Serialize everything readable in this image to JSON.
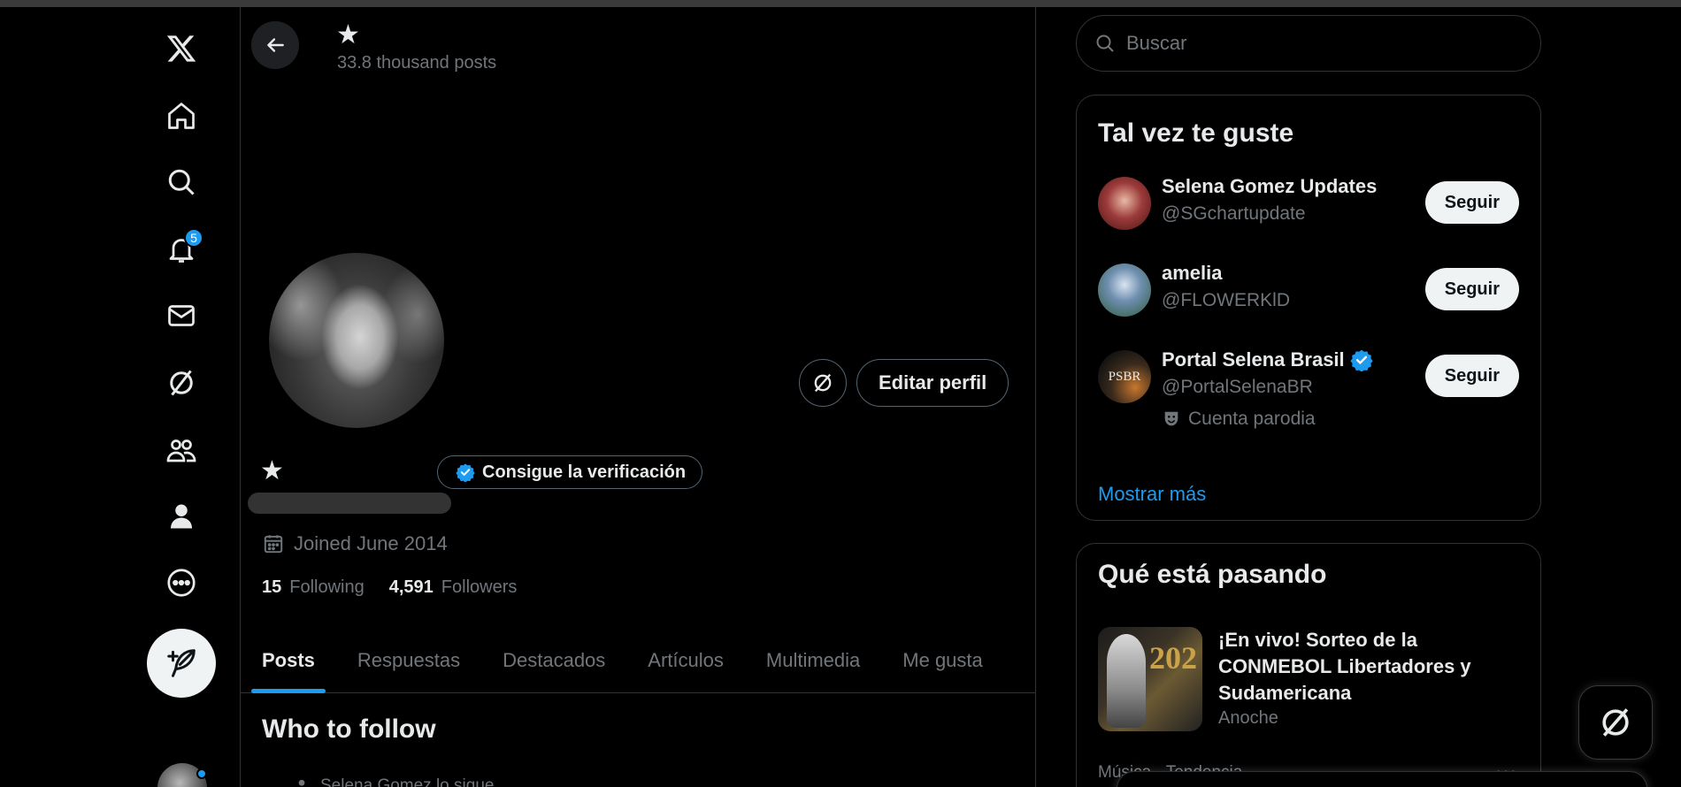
{
  "nav": {
    "logo": "x-logo-icon",
    "items": [
      {
        "name": "home-icon"
      },
      {
        "name": "search-icon"
      },
      {
        "name": "notifications-icon",
        "badge": "5"
      },
      {
        "name": "messages-icon"
      },
      {
        "name": "grok-icon"
      },
      {
        "name": "communities-icon"
      },
      {
        "name": "profile-icon"
      },
      {
        "name": "more-icon"
      }
    ],
    "post_button_icon": "compose-icon"
  },
  "header": {
    "name": "★",
    "posts_count": "33.8 thousand posts"
  },
  "profile": {
    "display_name": "★",
    "verify_label": "Consigue la verificación",
    "edit_label": "Editar perfil",
    "joined": "Joined June 2014",
    "following_count": "15",
    "following_label": "Following",
    "followers_count": "4,591",
    "followers_label": "Followers"
  },
  "tabs": [
    "Posts",
    "Respuestas",
    "Destacados",
    "Artículos",
    "Multimedia",
    "Me gusta"
  ],
  "who_to_follow": {
    "title": "Who to follow",
    "sub": "Selena Gomez lo sigue"
  },
  "search": {
    "placeholder": "Buscar"
  },
  "suggestions": {
    "title": "Tal vez te guste",
    "follow_label": "Seguir",
    "items": [
      {
        "name": "Selena Gomez Updates",
        "handle": "@SGchartupdate"
      },
      {
        "name": "amelia",
        "handle": "@FLOWERKlD"
      },
      {
        "name": "Portal Selena Brasil",
        "handle": "@PortalSelenaBR",
        "extra": "Cuenta parodia",
        "avatar_text": "PSBR"
      }
    ],
    "show_more": "Mostrar más"
  },
  "trends": {
    "title": "Qué está pasando",
    "item": {
      "text": "¡En vivo! Sorteo de la CONMEBOL Libertadores y Sudamericana",
      "time": "Anoche",
      "image_text": "202"
    },
    "category": "Música · Tendencia",
    "more": "···"
  },
  "colors": {
    "accent": "#1d9bf0",
    "bg": "#000000",
    "muted": "#71767b"
  }
}
